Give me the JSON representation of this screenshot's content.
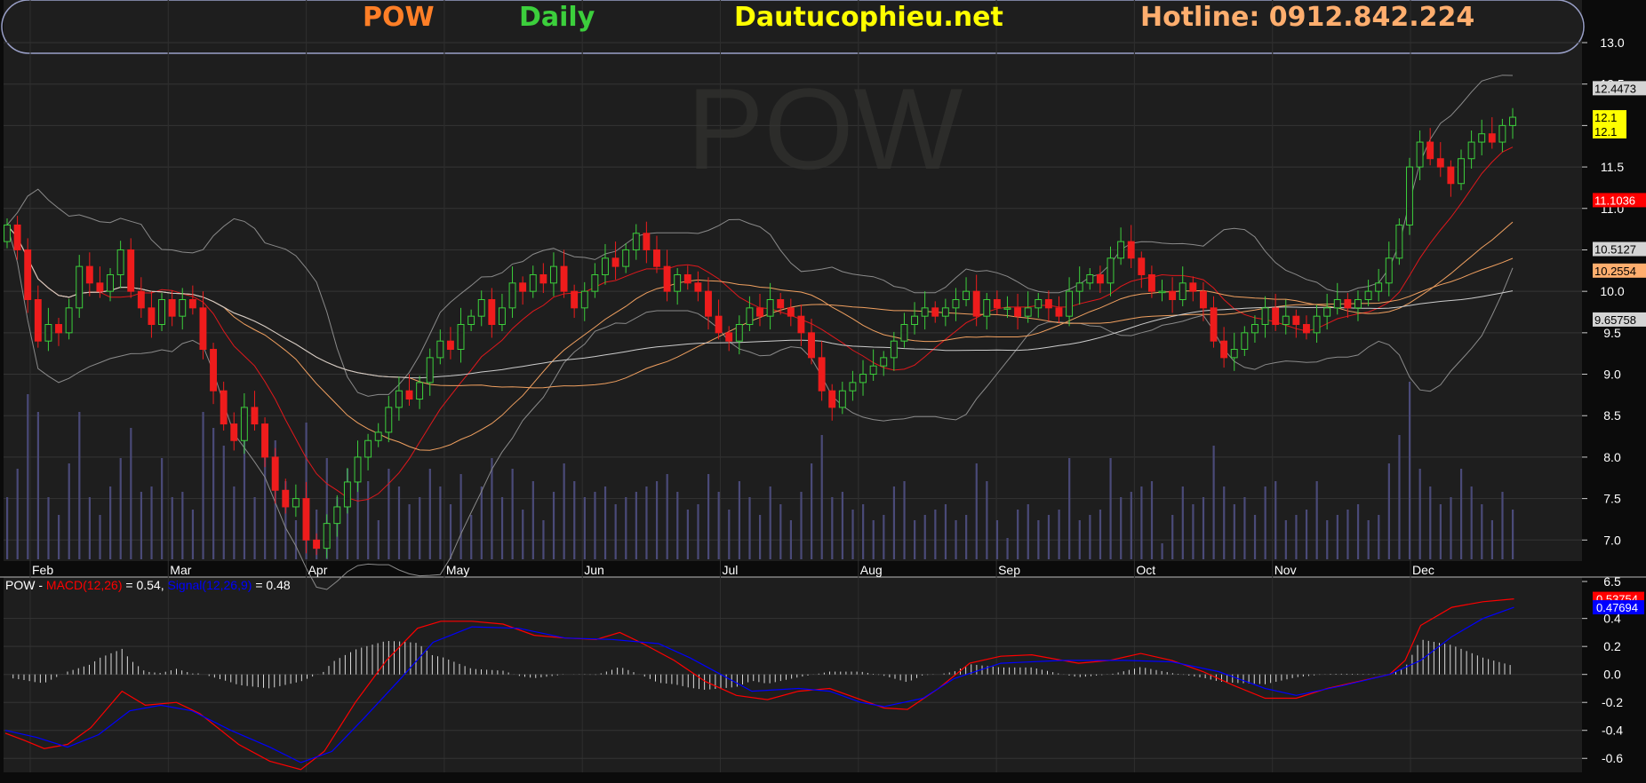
{
  "header": {
    "symbol": "POW",
    "period": "Daily",
    "site": "Dautucophieu.net",
    "hotline": "Hotline: 0912.842.224"
  },
  "colors": {
    "symbol": "#ff7f27",
    "period": "#3ccf3c",
    "site": "#ffff00",
    "hotline": "#ffae6e",
    "bull": "#3ccf3c",
    "bear": "#ee1c1c",
    "volume": "#4a4a78",
    "bollinger": "#8a8a8a",
    "ma_short": "#e0181c",
    "ma_mid": "#f0a060",
    "ma_long": "#cccccc",
    "macd": "#ff0000",
    "signal": "#0000ff"
  },
  "watermark": "POW",
  "chart_data": [
    {
      "type": "candlestick",
      "title": "POW Daily",
      "x_labels": [
        "Feb",
        "Mar",
        "Apr",
        "May",
        "Jun",
        "Jul",
        "Aug",
        "Sep",
        "Oct",
        "Nov",
        "Dec"
      ],
      "y_ticks": [
        "6.5",
        "7.0",
        "7.5",
        "8.0",
        "8.5",
        "9.0",
        "9.5",
        "10.0",
        "10.5",
        "11.0",
        "11.5",
        "12.0",
        "12.5",
        "13.0"
      ],
      "ylim": [
        6.5,
        13.0
      ],
      "price_tags": [
        {
          "label": "12.4473",
          "value": 12.45,
          "fill": "#d4d4d4",
          "color": "#000000"
        },
        {
          "label": "12.1",
          "value": 12.1,
          "fill": "#ffff00",
          "color": "#000000"
        },
        {
          "label": "12.1",
          "value": 11.93,
          "fill": "#ffff00",
          "color": "#000000"
        },
        {
          "label": "11.1036",
          "value": 11.1,
          "fill": "#ff0000",
          "color": "#ffffff"
        },
        {
          "label": "10.5127",
          "value": 10.51,
          "fill": "#d4d4d4",
          "color": "#000000"
        },
        {
          "label": "10.2554",
          "value": 10.25,
          "fill": "#ffae6e",
          "color": "#000000"
        },
        {
          "label": "9.65758",
          "value": 9.66,
          "fill": "#d4d4d4",
          "color": "#000000"
        }
      ],
      "close": [
        10.8,
        10.5,
        9.9,
        9.4,
        9.6,
        9.5,
        9.8,
        10.3,
        10.1,
        10.0,
        10.2,
        10.5,
        10.0,
        9.8,
        9.6,
        9.9,
        9.7,
        9.9,
        9.8,
        9.3,
        8.8,
        8.4,
        8.2,
        8.6,
        8.4,
        8.0,
        7.6,
        7.4,
        7.5,
        7.0,
        6.9,
        7.2,
        7.4,
        7.7,
        8.0,
        8.2,
        8.3,
        8.6,
        8.8,
        8.7,
        8.9,
        9.2,
        9.4,
        9.3,
        9.6,
        9.7,
        9.9,
        9.6,
        9.8,
        10.1,
        10.0,
        10.2,
        10.1,
        10.3,
        10.0,
        9.8,
        10.0,
        10.2,
        10.4,
        10.3,
        10.5,
        10.7,
        10.5,
        10.3,
        10.0,
        10.2,
        10.1,
        10.0,
        9.7,
        9.5,
        9.4,
        9.6,
        9.8,
        9.7,
        9.9,
        9.8,
        9.7,
        9.5,
        9.2,
        8.8,
        8.6,
        8.8,
        8.9,
        9.0,
        9.1,
        9.2,
        9.4,
        9.6,
        9.7,
        9.8,
        9.7,
        9.8,
        9.9,
        10.0,
        9.7,
        9.9,
        9.8,
        9.8,
        9.7,
        9.8,
        9.9,
        9.8,
        9.7,
        10.0,
        10.1,
        10.2,
        10.1,
        10.4,
        10.6,
        10.4,
        10.2,
        10.0,
        10.0,
        9.9,
        10.1,
        10.0,
        9.8,
        9.4,
        9.2,
        9.3,
        9.5,
        9.6,
        9.8,
        9.6,
        9.7,
        9.6,
        9.5,
        9.7,
        9.8,
        9.9,
        9.8,
        9.9,
        10.0,
        10.1,
        10.4,
        10.8,
        11.5,
        11.8,
        11.6,
        11.5,
        11.3,
        11.6,
        11.8,
        11.9,
        11.8,
        12.0,
        12.1
      ]
    },
    {
      "type": "line",
      "title": "MACD",
      "legend": {
        "symbol": "POW",
        "sep": " - ",
        "macd_label": "MACD(12,26)",
        "macd_value": " = 0.54, ",
        "signal_label": "Signal(12,26,9)",
        "signal_value": " = 0.48"
      },
      "y_ticks": [
        "0.4",
        "0.2",
        "0.0",
        "-0.2",
        "-0.4",
        "-0.6"
      ],
      "ylim": [
        -0.7,
        0.62
      ],
      "value_tags": [
        {
          "label": "0.53754",
          "value": 0.54,
          "fill": "#ff0000",
          "color": "#ffffff"
        },
        {
          "label": "0.47694",
          "value": 0.48,
          "fill": "#0000ff",
          "color": "#ffffff"
        }
      ],
      "series": [
        {
          "name": "MACD(12,26)",
          "points": [
            [
              0,
              -0.42
            ],
            [
              0.012,
              -0.47
            ],
            [
              0.025,
              -0.53
            ],
            [
              0.04,
              -0.5
            ],
            [
              0.055,
              -0.38
            ],
            [
              0.075,
              -0.12
            ],
            [
              0.09,
              -0.22
            ],
            [
              0.11,
              -0.2
            ],
            [
              0.125,
              -0.28
            ],
            [
              0.15,
              -0.5
            ],
            [
              0.17,
              -0.62
            ],
            [
              0.19,
              -0.68
            ],
            [
              0.205,
              -0.55
            ],
            [
              0.225,
              -0.2
            ],
            [
              0.245,
              0.1
            ],
            [
              0.265,
              0.33
            ],
            [
              0.28,
              0.38
            ],
            [
              0.3,
              0.38
            ],
            [
              0.32,
              0.36
            ],
            [
              0.34,
              0.28
            ],
            [
              0.36,
              0.26
            ],
            [
              0.38,
              0.25
            ],
            [
              0.395,
              0.3
            ],
            [
              0.41,
              0.22
            ],
            [
              0.43,
              0.1
            ],
            [
              0.45,
              -0.05
            ],
            [
              0.47,
              -0.15
            ],
            [
              0.49,
              -0.18
            ],
            [
              0.51,
              -0.12
            ],
            [
              0.53,
              -0.1
            ],
            [
              0.55,
              -0.18
            ],
            [
              0.565,
              -0.24
            ],
            [
              0.58,
              -0.25
            ],
            [
              0.6,
              -0.1
            ],
            [
              0.62,
              0.08
            ],
            [
              0.64,
              0.13
            ],
            [
              0.66,
              0.14
            ],
            [
              0.69,
              0.08
            ],
            [
              0.71,
              0.1
            ],
            [
              0.73,
              0.15
            ],
            [
              0.75,
              0.1
            ],
            [
              0.77,
              0.02
            ],
            [
              0.79,
              -0.08
            ],
            [
              0.81,
              -0.17
            ],
            [
              0.83,
              -0.17
            ],
            [
              0.85,
              -0.1
            ],
            [
              0.87,
              -0.05
            ],
            [
              0.89,
              0.0
            ],
            [
              0.9,
              0.1
            ],
            [
              0.91,
              0.35
            ],
            [
              0.93,
              0.48
            ],
            [
              0.95,
              0.52
            ],
            [
              0.97,
              0.54
            ]
          ]
        },
        {
          "name": "Signal(12,26,9)",
          "points": [
            [
              0,
              -0.4
            ],
            [
              0.02,
              -0.45
            ],
            [
              0.04,
              -0.52
            ],
            [
              0.06,
              -0.43
            ],
            [
              0.08,
              -0.26
            ],
            [
              0.1,
              -0.22
            ],
            [
              0.12,
              -0.26
            ],
            [
              0.145,
              -0.4
            ],
            [
              0.17,
              -0.52
            ],
            [
              0.19,
              -0.63
            ],
            [
              0.21,
              -0.55
            ],
            [
              0.23,
              -0.32
            ],
            [
              0.255,
              -0.02
            ],
            [
              0.275,
              0.23
            ],
            [
              0.3,
              0.34
            ],
            [
              0.33,
              0.33
            ],
            [
              0.36,
              0.26
            ],
            [
              0.39,
              0.25
            ],
            [
              0.42,
              0.22
            ],
            [
              0.44,
              0.12
            ],
            [
              0.46,
              0.0
            ],
            [
              0.48,
              -0.12
            ],
            [
              0.51,
              -0.1
            ],
            [
              0.53,
              -0.12
            ],
            [
              0.55,
              -0.2
            ],
            [
              0.565,
              -0.23
            ],
            [
              0.59,
              -0.17
            ],
            [
              0.61,
              -0.03
            ],
            [
              0.64,
              0.08
            ],
            [
              0.68,
              0.1
            ],
            [
              0.72,
              0.1
            ],
            [
              0.75,
              0.09
            ],
            [
              0.78,
              0.02
            ],
            [
              0.81,
              -0.1
            ],
            [
              0.83,
              -0.15
            ],
            [
              0.86,
              -0.08
            ],
            [
              0.89,
              0.0
            ],
            [
              0.91,
              0.1
            ],
            [
              0.93,
              0.27
            ],
            [
              0.95,
              0.4
            ],
            [
              0.97,
              0.48
            ]
          ]
        }
      ]
    }
  ]
}
